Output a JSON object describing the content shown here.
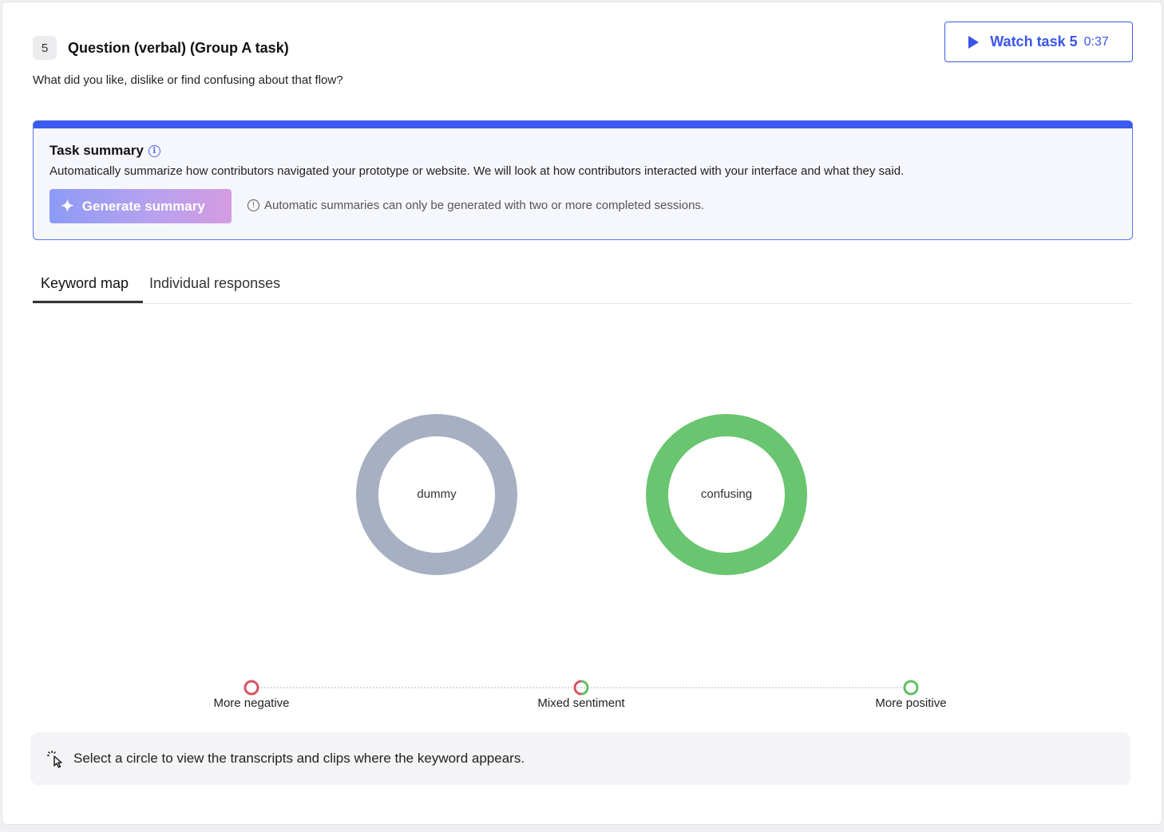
{
  "task": {
    "number": "5",
    "title": "Question (verbal) (Group A task)",
    "question": "What did you like, dislike or find confusing about that flow?",
    "watch_label": "Watch task 5",
    "watch_duration": "0:37"
  },
  "summary": {
    "title": "Task summary",
    "description": "Automatically summarize how contributors navigated your prototype or website. We will look at how contributors interacted with your interface and what they said.",
    "generate_label": "Generate summary",
    "note": "Automatic summaries can only be generated with two or more completed sessions."
  },
  "tabs": [
    {
      "label": "Keyword map",
      "active": true
    },
    {
      "label": "Individual responses",
      "active": false
    }
  ],
  "keywords": [
    {
      "label": "dummy",
      "sentiment": "neutral",
      "color": "#a6b0c2"
    },
    {
      "label": "confusing",
      "sentiment": "positive",
      "color": "#69c56f"
    }
  ],
  "legend": {
    "negative": "More negative",
    "mixed": "Mixed sentiment",
    "positive": "More positive",
    "negative_color": "#d85364",
    "positive_color": "#5fbf62"
  },
  "hint": "Select a circle to view the transcripts and clips where the keyword appears.",
  "colors": {
    "accent": "#3b5bf0",
    "summary_bg": "#f6f7fc"
  }
}
